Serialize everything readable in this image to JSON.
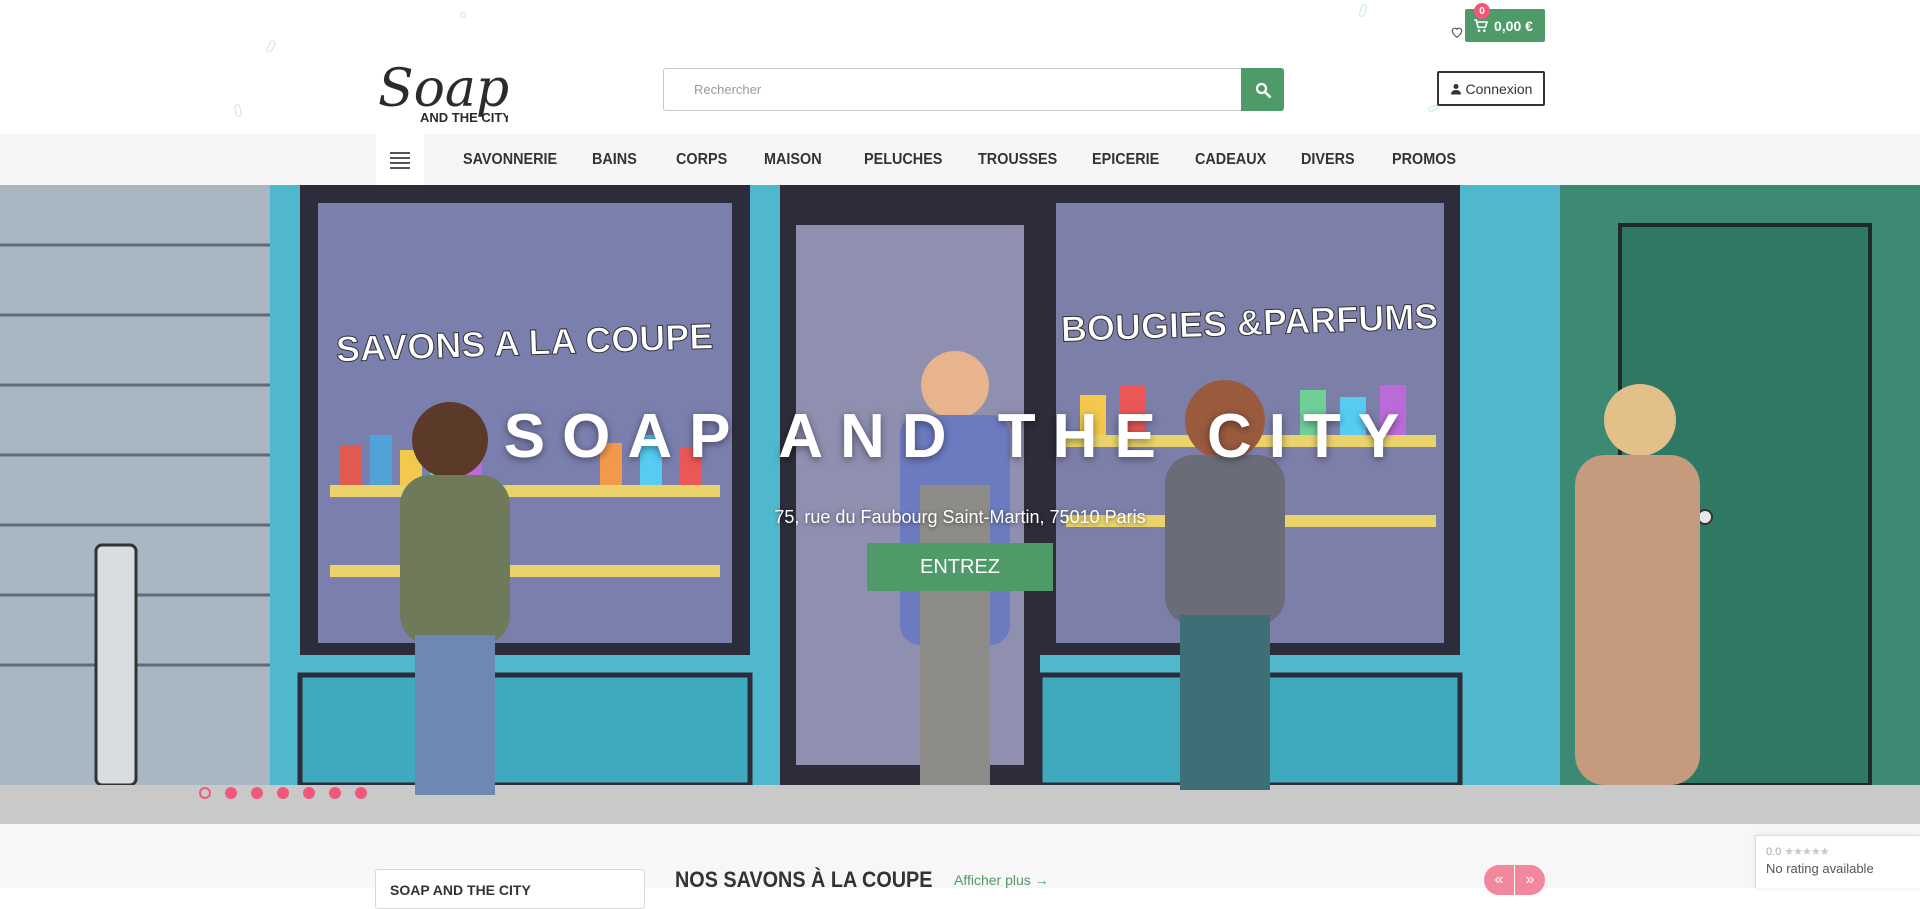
{
  "header": {
    "logo_text": "Soap",
    "logo_subtext": "AND THE CITY",
    "search": {
      "placeholder": "Rechercher"
    },
    "cart": {
      "count": "0",
      "total": "0,00 €"
    },
    "login_label": "Connexion"
  },
  "nav": {
    "items": [
      "SAVONNERIE",
      "BAINS",
      "CORPS",
      "MAISON",
      "PELUCHES",
      "TROUSSES",
      "EPICERIE",
      "CADEAUX",
      "DIVERS",
      "PROMOS"
    ]
  },
  "hero": {
    "title": "SOAP AND THE CITY",
    "subtitle": "75, rue du Faubourg Saint-Martin, 75010 Paris",
    "cta_label": "ENTREZ",
    "shop_sign_left": "SAVONS A LA COUPE",
    "shop_sign_right": "BOUGIES &PARFUMS",
    "slides": 7,
    "active_slide": 0
  },
  "section": {
    "sidebar_box": "SOAP AND THE CITY",
    "title": "NOS SAVONS À LA COUPE",
    "see_more": "Afficher plus →",
    "prev_icon": "«",
    "next_icon": "»"
  },
  "rating_badge": {
    "score": "0.0",
    "label": "No rating available"
  },
  "colors": {
    "brand_green": "#4e9a68",
    "accent_pink": "#f0587a",
    "hero_blue": "#5fb9cd"
  }
}
